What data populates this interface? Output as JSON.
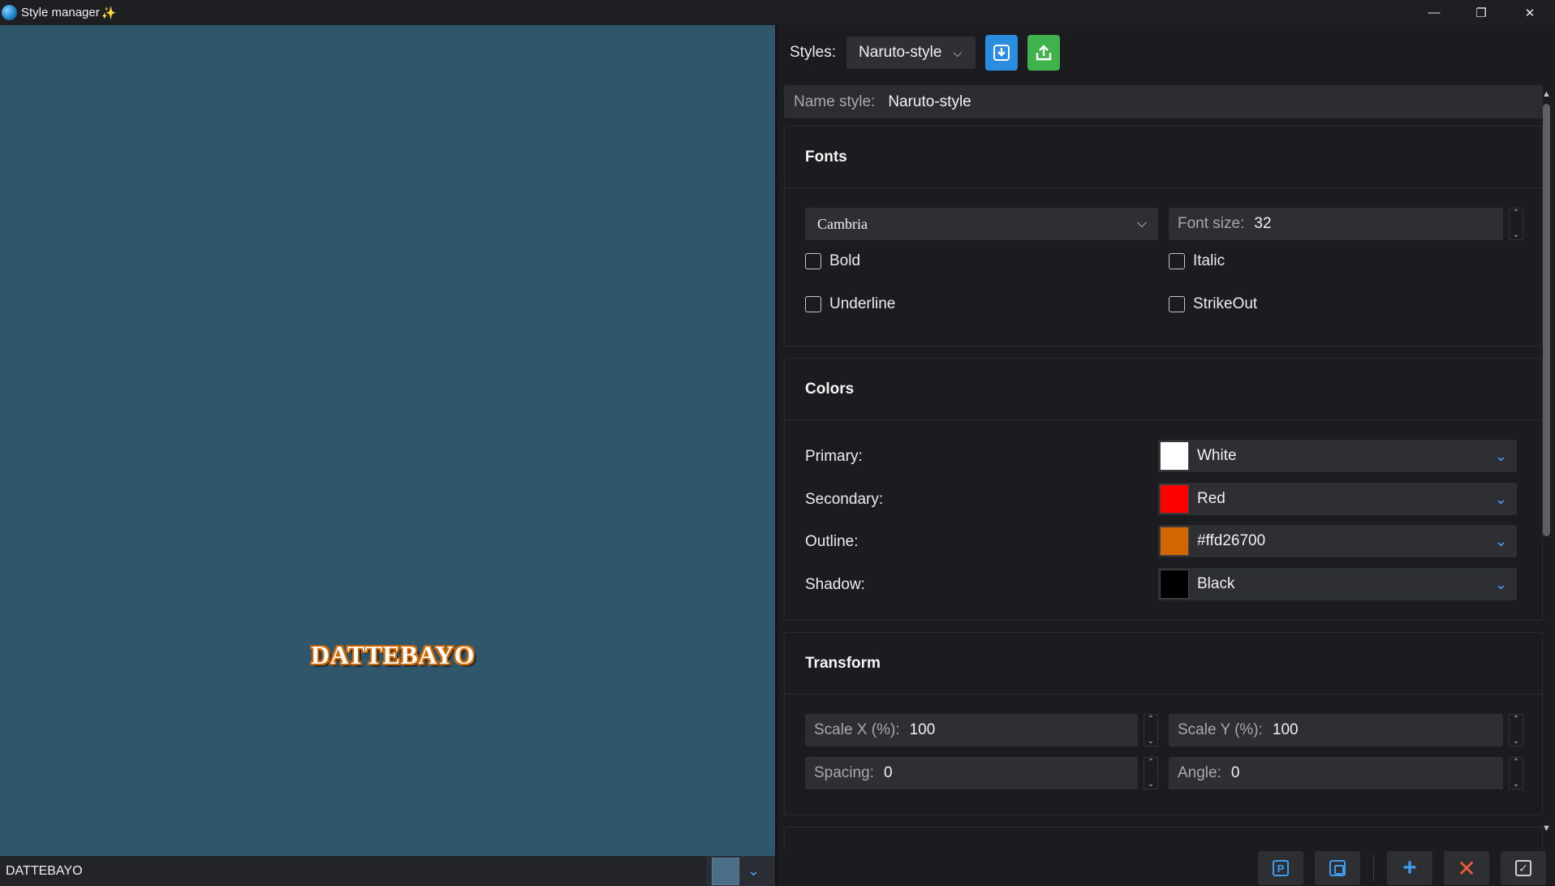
{
  "window": {
    "title": "Style manager",
    "title_icon": "sparkle-icon",
    "app_icon": "globe-icon",
    "controls": {
      "minimize": "—",
      "maximize": "❐",
      "close": "✕"
    }
  },
  "preview": {
    "text": "DATTEBAYO",
    "background_color": "#30566c",
    "input_value": "DATTEBAYO"
  },
  "styles_bar": {
    "label": "Styles:",
    "selected": "Naruto-style",
    "import_icon": "download-icon",
    "export_icon": "upload-icon"
  },
  "name_style": {
    "label": "Name style:",
    "value": "Naruto-style"
  },
  "fonts": {
    "heading": "Fonts",
    "font_family": "Cambria",
    "font_size_label": "Font size:",
    "font_size_value": "32",
    "bold": {
      "label": "Bold",
      "checked": false
    },
    "italic": {
      "label": "Italic",
      "checked": false
    },
    "underline": {
      "label": "Underline",
      "checked": false
    },
    "strikeout": {
      "label": "StrikeOut",
      "checked": false
    }
  },
  "colors": {
    "heading": "Colors",
    "items": [
      {
        "label": "Primary:",
        "name": "White",
        "hex": "#ffffff"
      },
      {
        "label": "Secondary:",
        "name": "Red",
        "hex": "#ff0000"
      },
      {
        "label": "Outline:",
        "name": "#ffd26700",
        "hex": "#d26700"
      },
      {
        "label": "Shadow:",
        "name": "Black",
        "hex": "#000000"
      }
    ]
  },
  "transform": {
    "heading": "Transform",
    "scale_x_label": "Scale X (%):",
    "scale_x_value": "100",
    "scale_y_label": "Scale Y (%):",
    "scale_y_value": "100",
    "spacing_label": "Spacing:",
    "spacing_value": "0",
    "angle_label": "Angle:",
    "angle_value": "0"
  },
  "bottom_actions": [
    {
      "name": "preview-icon",
      "glyph": "P"
    },
    {
      "name": "duplicate-icon"
    },
    {
      "name": "add-icon",
      "glyph": "+"
    },
    {
      "name": "delete-icon",
      "glyph": "✕"
    },
    {
      "name": "apply-icon",
      "glyph": "✓"
    }
  ]
}
